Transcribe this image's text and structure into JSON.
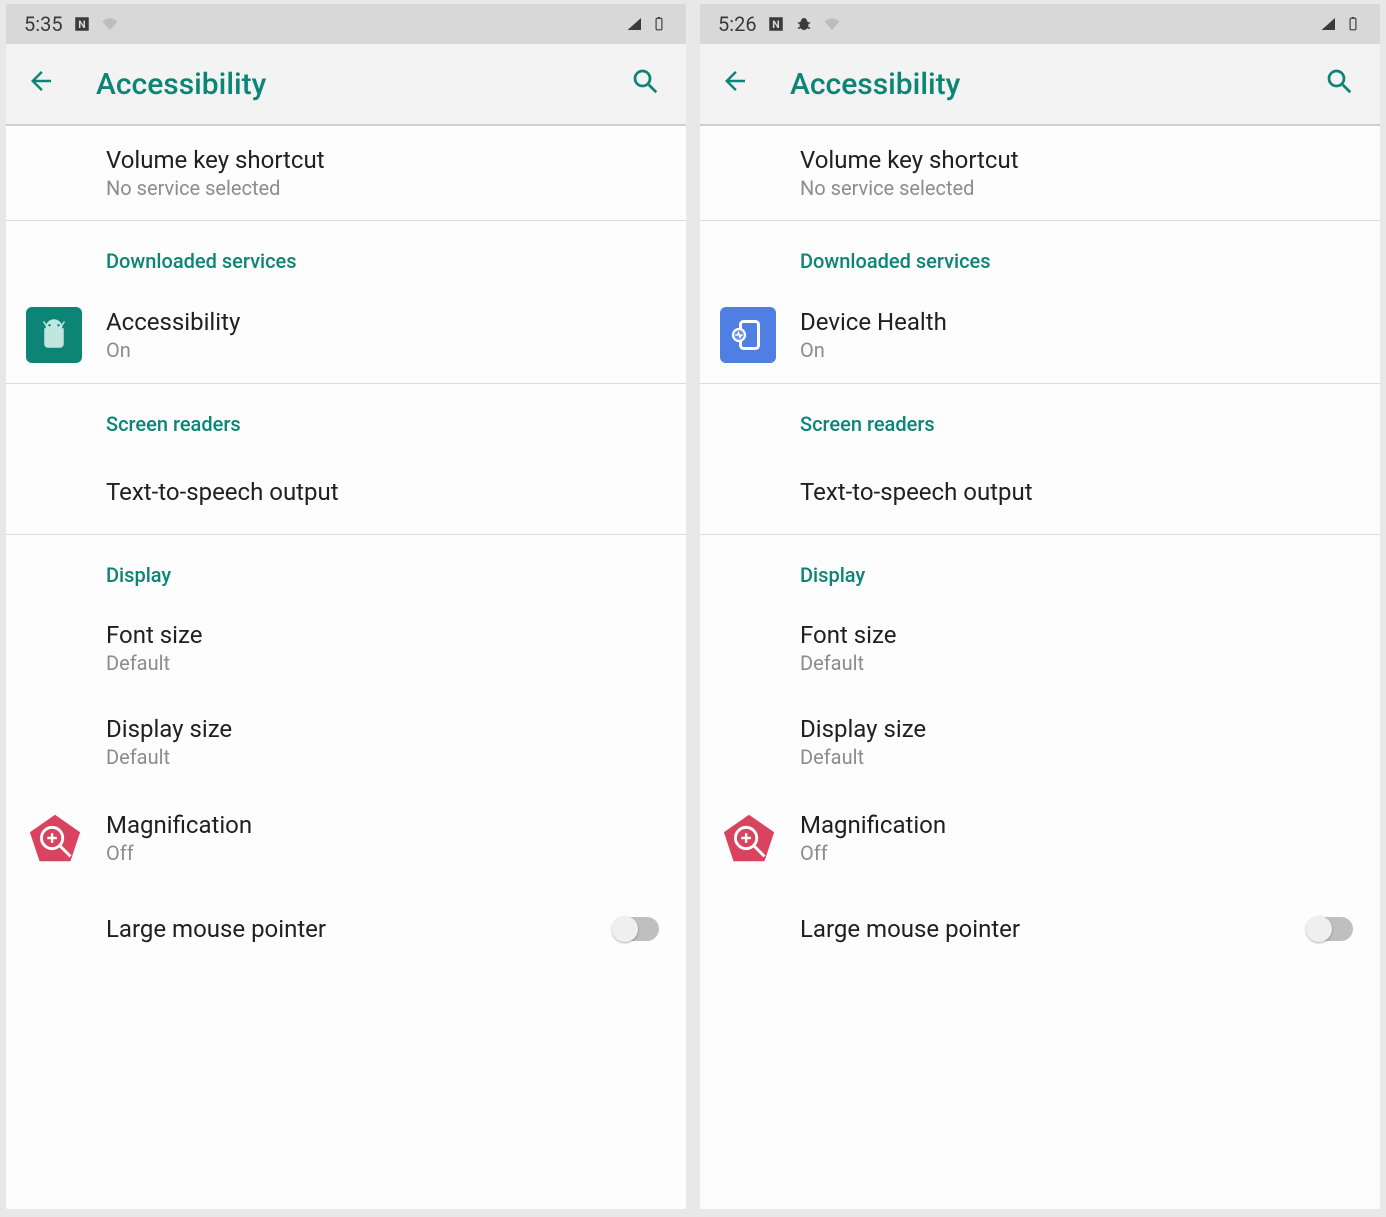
{
  "left": {
    "status": {
      "time": "5:35"
    },
    "title": "Accessibility",
    "vks": {
      "title": "Volume key shortcut",
      "subtitle": "No service selected"
    },
    "section_downloaded": "Downloaded services",
    "service": {
      "title": "Accessibility",
      "subtitle": "On"
    },
    "section_readers": "Screen readers",
    "tts": "Text-to-speech output",
    "section_display": "Display",
    "font": {
      "title": "Font size",
      "subtitle": "Default"
    },
    "dsize": {
      "title": "Display size",
      "subtitle": "Default"
    },
    "mag": {
      "title": "Magnification",
      "subtitle": "Off"
    },
    "lmp": "Large mouse pointer"
  },
  "right": {
    "status": {
      "time": "5:26"
    },
    "title": "Accessibility",
    "vks": {
      "title": "Volume key shortcut",
      "subtitle": "No service selected"
    },
    "section_downloaded": "Downloaded services",
    "service": {
      "title": "Device Health",
      "subtitle": "On"
    },
    "section_readers": "Screen readers",
    "tts": "Text-to-speech output",
    "section_display": "Display",
    "font": {
      "title": "Font size",
      "subtitle": "Default"
    },
    "dsize": {
      "title": "Display size",
      "subtitle": "Default"
    },
    "mag": {
      "title": "Magnification",
      "subtitle": "Off"
    },
    "lmp": "Large mouse pointer"
  }
}
